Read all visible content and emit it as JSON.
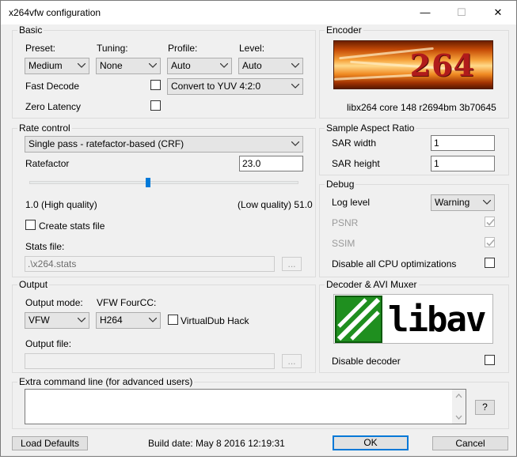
{
  "window": {
    "title": "x264vfw configuration",
    "minimize": "—",
    "maximize": "☐",
    "close": "✕"
  },
  "basic": {
    "legend": "Basic",
    "preset_label": "Preset:",
    "preset": "Medium",
    "tuning_label": "Tuning:",
    "tuning": "None",
    "profile_label": "Profile:",
    "profile": "Auto",
    "level_label": "Level:",
    "level": "Auto",
    "fast_decode_label": "Fast Decode",
    "zero_latency_label": "Zero Latency",
    "colorspace": "Convert to YUV 4:2:0"
  },
  "encoder": {
    "legend": "Encoder",
    "logo_text": "264",
    "version": "libx264 core 148 r2694bm 3b70645"
  },
  "rate_control": {
    "legend": "Rate control",
    "mode": "Single pass - ratefactor-based (CRF)",
    "ratefactor_label": "Ratefactor",
    "ratefactor": "23.0",
    "slider_level": 0.44,
    "min_label": "1.0 (High quality)",
    "max_label": "(Low quality) 51.0",
    "create_stats_label": "Create stats file",
    "stats_file_label": "Stats file:",
    "stats_file": ".\\x264.stats",
    "browse_label": "..."
  },
  "sar": {
    "legend": "Sample Aspect Ratio",
    "width_label": "SAR width",
    "width": "1",
    "height_label": "SAR height",
    "height": "1"
  },
  "debug": {
    "legend": "Debug",
    "log_level_label": "Log level",
    "log_level": "Warning",
    "psnr_label": "PSNR",
    "ssim_label": "SSIM",
    "disable_cpu_label": "Disable all CPU optimizations"
  },
  "output": {
    "legend": "Output",
    "mode_label": "Output mode:",
    "mode": "VFW",
    "fourcc_label": "VFW FourCC:",
    "fourcc": "H264",
    "vdub_hack_label": "VirtualDub Hack",
    "file_label": "Output file:",
    "file": "",
    "browse_label": "..."
  },
  "decoder": {
    "legend": "Decoder & AVI Muxer",
    "logo_text": "libav",
    "disable_label": "Disable decoder"
  },
  "extra": {
    "legend": "Extra command line (for advanced users)",
    "text": "",
    "help_label": "?"
  },
  "footer": {
    "load_defaults": "Load Defaults",
    "build_date": "Build date: May  8 2016 12:19:31",
    "ok": "OK",
    "cancel": "Cancel"
  },
  "colors": {
    "accent": "#0078d7",
    "slider_thumb": "#007ad9",
    "libav_green": "#2a9a2a"
  }
}
